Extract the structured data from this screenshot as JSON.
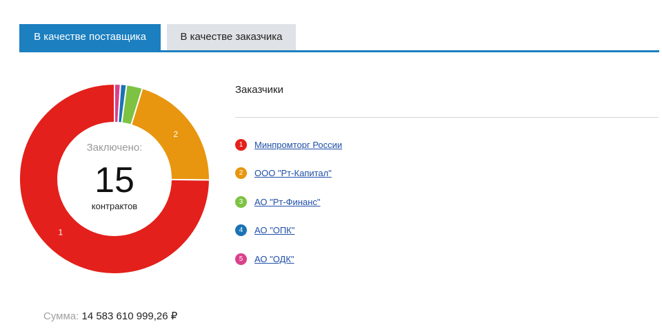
{
  "tabs": [
    {
      "label": "В качестве поставщика",
      "active": true
    },
    {
      "label": "В качестве заказчика",
      "active": false
    }
  ],
  "summary": {
    "label_top": "Заключено:",
    "count": "15",
    "label_bottom": "контрактов"
  },
  "chart_data": {
    "type": "pie",
    "title": "",
    "slices": [
      {
        "label": "1",
        "name": "Минпромторг России",
        "value": 11,
        "color": "#e3201b"
      },
      {
        "label": "2",
        "name": "ООО \"Рт-Капитал\"",
        "value": 3,
        "color": "#e8960f"
      },
      {
        "label": "3",
        "name": "АО \"Рт-Финанс\"",
        "value": 0.4,
        "color": "#7dc242"
      },
      {
        "label": "4",
        "name": "АО \"ОПК\"",
        "value": 0.15,
        "color": "#1b73b5"
      },
      {
        "label": "5",
        "name": "АО \"ОДК\"",
        "value": 0.15,
        "color": "#d9418a"
      }
    ]
  },
  "legend": {
    "title": "Заказчики",
    "items": [
      {
        "num": "1",
        "name": "Минпромторг России",
        "color": "#e3201b"
      },
      {
        "num": "2",
        "name": "ООО \"Рт-Капитал\"",
        "color": "#e8960f"
      },
      {
        "num": "3",
        "name": "АО \"Рт-Финанс\"",
        "color": "#7dc242"
      },
      {
        "num": "4",
        "name": "АО \"ОПК\"",
        "color": "#1b73b5"
      },
      {
        "num": "5",
        "name": "АО \"ОДК\"",
        "color": "#d9418a"
      }
    ]
  },
  "sum": {
    "label": "Сумма:",
    "value": "14 583 610 999,26 ₽"
  }
}
